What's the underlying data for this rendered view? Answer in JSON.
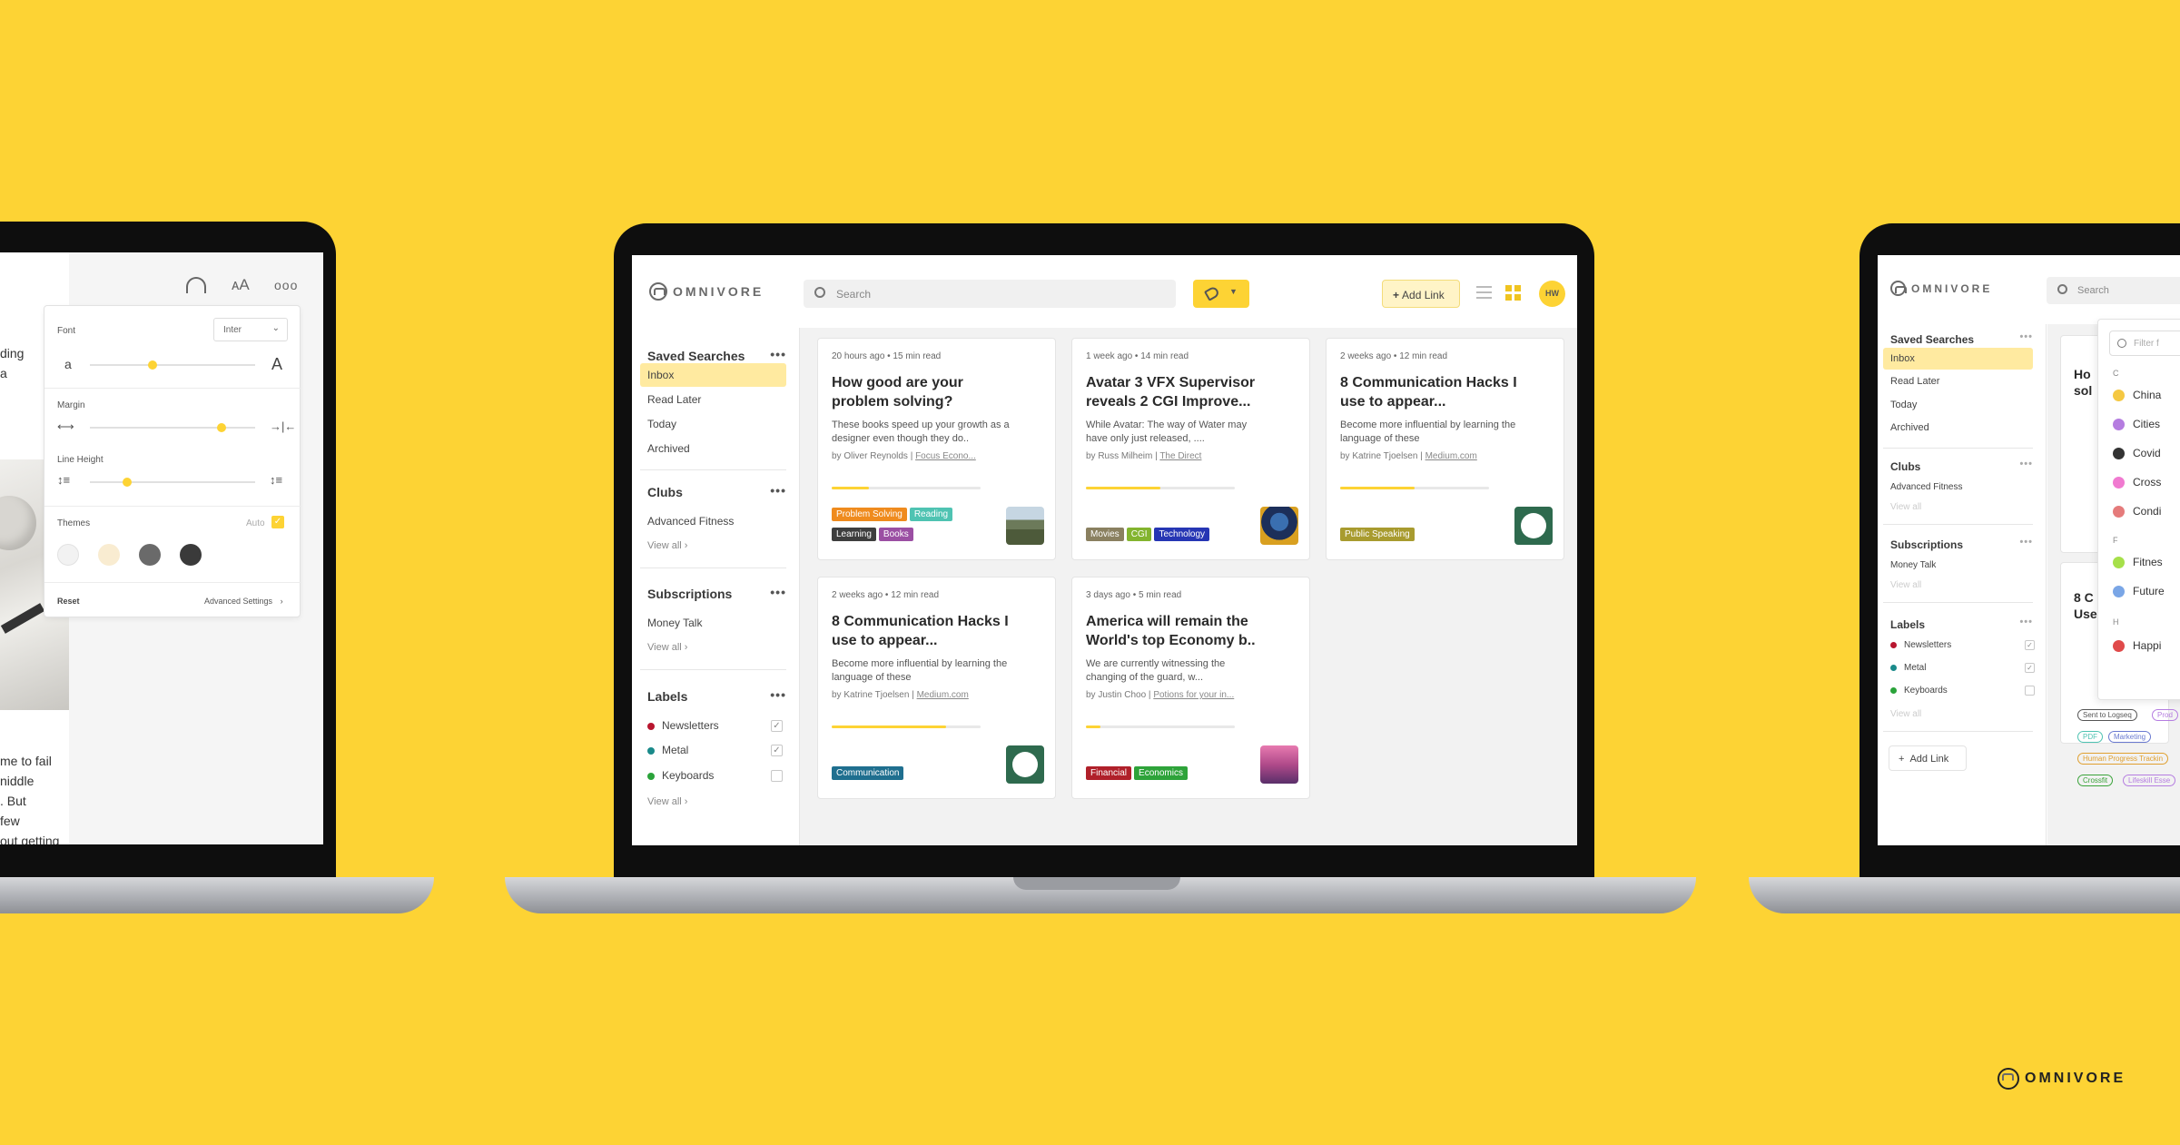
{
  "colors": {
    "background": "#fdd334",
    "accent": "#fdd334",
    "selected": "#ffeaa0"
  },
  "brand": {
    "name": "OMNIVORE",
    "icon": "omnivore-logo-icon"
  },
  "left": {
    "icons": [
      "headphones-icon",
      "text-size-icon",
      "more-icon"
    ],
    "reader_text": [
      "ding",
      "a",
      "me to fail",
      "niddle",
      ". But",
      " few",
      "out getting"
    ],
    "panel": {
      "font_label": "Font",
      "font_value": "Inter",
      "small_a": "a",
      "big_a": "A",
      "margin_label": "Margin",
      "line_height_label": "Line Height",
      "themes_label": "Themes",
      "auto_label": "Auto",
      "reset_label": "Reset",
      "advanced_label": "Advanced Settings",
      "font_slider": 0.35,
      "margin_slider": 0.8,
      "line_height_slider": 0.2,
      "theme_colors": [
        "#f2f2f2",
        "#f9ecd1",
        "#6a6a6a",
        "#3a3a3a"
      ]
    }
  },
  "center": {
    "search_placeholder": "Search",
    "add_link": "Add Link",
    "avatar": "HW",
    "sidebar": {
      "saved_searches": "Saved Searches",
      "saved_items": [
        "Inbox",
        "Read Later",
        "Today",
        "Archived"
      ],
      "clubs": "Clubs",
      "club_items": [
        "Advanced Fitness"
      ],
      "subscriptions": "Subscriptions",
      "subscription_items": [
        "Money Talk"
      ],
      "labels": "Labels",
      "label_items": [
        {
          "name": "Newsletters",
          "color": "#b8162f",
          "checked": "✓"
        },
        {
          "name": "Metal",
          "color": "#1a8a8a",
          "checked": "✓"
        },
        {
          "name": "Keyboards",
          "color": "#2aa33a",
          "checked": ""
        }
      ],
      "view_all": "View all ›",
      "more": "•••"
    },
    "cards": [
      {
        "meta": "20 hours ago • 15 min read",
        "title": "How good are your problem solving?",
        "desc": "These books speed up your growth as a designer even though they do..",
        "by": "by Oliver Reynolds | ",
        "source": "Focus Econo...",
        "progress": 0.25,
        "tags": [
          {
            "t": "Problem Solving",
            "c": "#ef8b1e"
          },
          {
            "t": "Reading",
            "c": "#4fc3b2"
          },
          {
            "t": "Learning",
            "c": "#3e3e3e"
          },
          {
            "t": "Books",
            "c": "#9b4fa3"
          }
        ],
        "thumb": "landscape-thumbnail"
      },
      {
        "meta": "1 week ago • 14 min read",
        "title": "Avatar 3 VFX Supervisor reveals 2 CGI Improve...",
        "desc": "While Avatar: The way of Water may have only just released, ....",
        "by": "by Russ Milheim | ",
        "source": "The Direct",
        "progress": 0.5,
        "tags": [
          {
            "t": "Movies",
            "c": "#8a8060"
          },
          {
            "t": "CGI",
            "c": "#83b42f"
          },
          {
            "t": "Technology",
            "c": "#2636b4"
          }
        ],
        "thumb": "avatar-thumbnail"
      },
      {
        "meta": "2 weeks ago • 12 min read",
        "title": "8 Communication Hacks I use to appear...",
        "desc": "Become more influential by learning the language of these",
        "by": "by Katrine Tjoelsen | ",
        "source": "Medium.com",
        "progress": 0.5,
        "tags": [
          {
            "t": "Public Speaking",
            "c": "#a89b2f"
          }
        ],
        "thumb": "people-thumbnail"
      },
      {
        "meta": "2 weeks ago • 12 min read",
        "title": "8 Communication Hacks I use to appear...",
        "desc": "Become more influential by learning the language of these",
        "by": "by Katrine Tjoelsen | ",
        "source": "Medium.com",
        "progress": 0.77,
        "tags": [
          {
            "t": "Communication",
            "c": "#1f6f8f"
          }
        ],
        "thumb": "people-thumbnail"
      },
      {
        "meta": "3 days ago • 5 min read",
        "title": "America will remain the World's top Economy b..",
        "desc": "We are currently witnessing the changing of the guard, w...",
        "by": "by Justin Choo | ",
        "source": "Potions for your in...",
        "progress": 0.1,
        "tags": [
          {
            "t": "Financial",
            "c": "#b0202a"
          },
          {
            "t": "Economics",
            "c": "#2ea33a"
          }
        ],
        "thumb": "sunset-thumbnail"
      }
    ]
  },
  "right": {
    "search_placeholder": "Search",
    "filter_placeholder": "Filter f",
    "sidebar": {
      "saved_searches": "Saved Searches",
      "saved_items": [
        "Inbox",
        "Read Later",
        "Today",
        "Archived"
      ],
      "clubs": "Clubs",
      "club_items": [
        "Advanced Fitness"
      ],
      "subscriptions": "Subscriptions",
      "subscription_items": [
        "Money Talk"
      ],
      "labels": "Labels",
      "label_items": [
        "Newsletters",
        "Metal",
        "Keyboards"
      ],
      "view_all": "View all",
      "add_link": "Add Link"
    },
    "letters": [
      "C",
      "F",
      "H"
    ],
    "label_list": [
      {
        "name": "China",
        "color": "#f5c842"
      },
      {
        "name": "Cities",
        "color": "#b57de0"
      },
      {
        "name": "Covid",
        "color": "#333333"
      },
      {
        "name": "Cross",
        "color": "#f07ad0"
      },
      {
        "name": "Condi",
        "color": "#e57b7b"
      },
      {
        "name": "Fitnes",
        "color": "#a6e04a"
      },
      {
        "name": "Future",
        "color": "#7aa6e6"
      },
      {
        "name": "Happi",
        "color": "#e04a4a"
      }
    ],
    "pill_tags": [
      {
        "t": "Sent to Logseq",
        "c": "#555555"
      },
      {
        "t": "Prod",
        "c": "#b57de0"
      },
      {
        "t": "PDF",
        "c": "#4fc3b2"
      },
      {
        "t": "Marketing",
        "c": "#6a7ad0"
      },
      {
        "t": "Human Progress Trackin",
        "c": "#e0a030"
      },
      {
        "t": "Crossfit",
        "c": "#3aa33a"
      },
      {
        "t": "Lifeskill Esse",
        "c": "#b57de0"
      }
    ],
    "card_fragments": [
      "Ho",
      "sol",
      "8 C",
      "Use"
    ]
  },
  "corner_brand": "OMNIVORE"
}
